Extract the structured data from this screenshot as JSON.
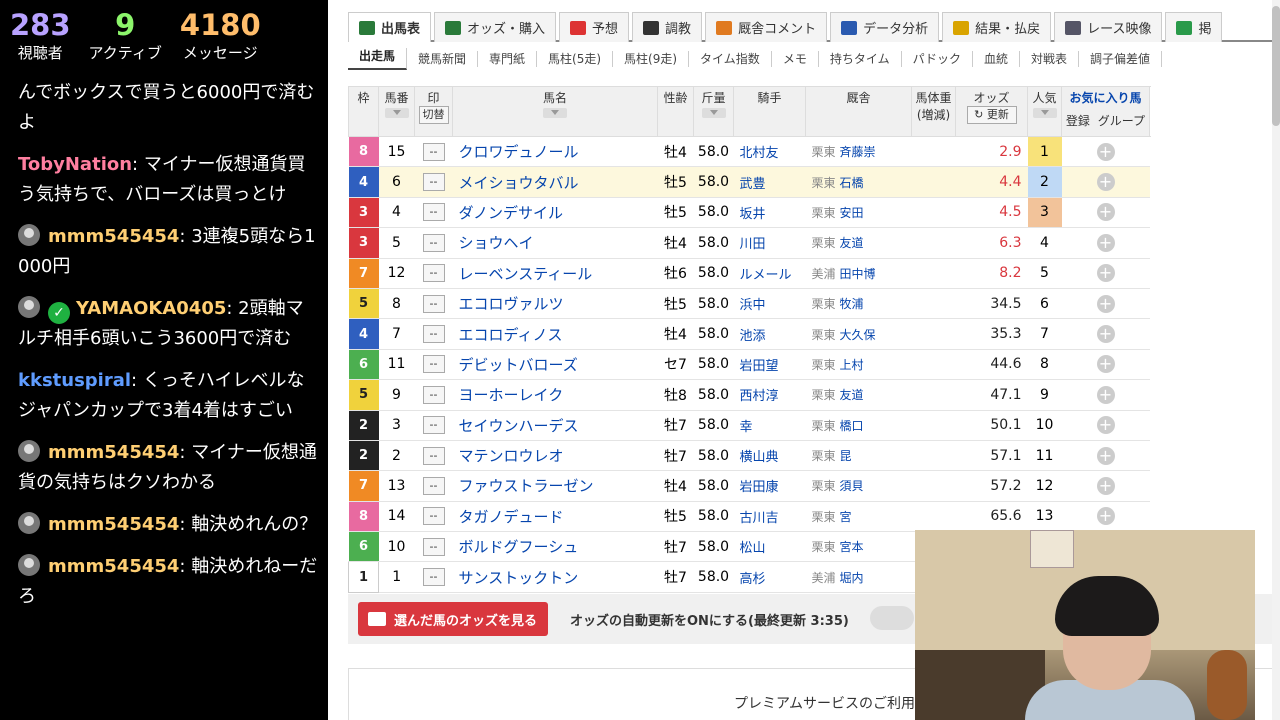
{
  "stream": {
    "stats": [
      {
        "value": "283",
        "label": "視聴者",
        "color": "#b8a2ff"
      },
      {
        "value": "9",
        "label": "アクティブ",
        "color": "#8cf56b"
      },
      {
        "value": "4180",
        "label": "メッセージ",
        "color": "#ffbd6b"
      }
    ],
    "chat": [
      {
        "user": "",
        "text": "んでボックスで買うと6000円で済むよ",
        "color": "#ffffff",
        "avatar": false,
        "verified": false
      },
      {
        "user": "TobyNation",
        "text": ": マイナー仮想通貨買う気持ちで、バローズ￼は買っとけ",
        "color": "#ff7fa0",
        "avatar": false,
        "verified": false
      },
      {
        "user": "mmm545454",
        "text": ": 3連複5頭なら1000円",
        "color": "#ffcf73",
        "avatar": true,
        "verified": false
      },
      {
        "user": "YAMAOKA0405",
        "text": ": 2頭軸マルチ相手6頭いこう3600円で済む",
        "color": "#ffcf73",
        "avatar": true,
        "verified": true
      },
      {
        "user": "kkstuspiral",
        "text": ": くっそハイレベルなジャパンカップで3着4着はすごい",
        "color": "#5f9cff",
        "avatar": false,
        "verified": false
      },
      {
        "user": "mmm545454",
        "text": ": マイナー仮想通貨の気持ちはクソわかる",
        "color": "#ffcf73",
        "avatar": true,
        "verified": false
      },
      {
        "user": "mmm545454",
        "text": ": 軸決めれんの？",
        "color": "#ffcf73",
        "avatar": true,
        "verified": false
      },
      {
        "user": "mmm545454",
        "text": ": 軸決めれねーだろ",
        "color": "#ffcf73",
        "avatar": true,
        "verified": false
      }
    ]
  },
  "tabs": [
    {
      "label": "出馬表",
      "active": true,
      "icon": "table-icon",
      "color": "#2a7a3a"
    },
    {
      "label": "オッズ・購入",
      "active": false,
      "icon": "ticket-icon",
      "color": "#2a7a3a"
    },
    {
      "label": "予想",
      "active": false,
      "icon": "target-icon",
      "color": "#d33"
    },
    {
      "label": "調教",
      "active": false,
      "icon": "stopwatch-icon",
      "color": "#333"
    },
    {
      "label": "厩舎コメント",
      "active": false,
      "icon": "house-icon",
      "color": "#e07a20"
    },
    {
      "label": "データ分析",
      "active": false,
      "icon": "bar-chart-icon",
      "color": "#2a5ab0"
    },
    {
      "label": "結果・払戻",
      "active": false,
      "icon": "coin-icon",
      "color": "#d9a400"
    },
    {
      "label": "レース映像",
      "active": false,
      "icon": "video-icon",
      "color": "#556"
    },
    {
      "label": "掲",
      "active": false,
      "icon": "chat-icon",
      "color": "#2a9a4a"
    }
  ],
  "subtabs": [
    "出走馬",
    "競馬新聞",
    "専門紙",
    "馬柱(5走)",
    "馬柱(9走)",
    "タイム指数",
    "メモ",
    "持ちタイム",
    "パドック",
    "血統",
    "対戦表",
    "調子偏差値"
  ],
  "headers": {
    "waku": "枠",
    "umaban": "馬番",
    "mark": "印",
    "mark_sub": "切替",
    "name": "馬名",
    "sex_age": "性齢",
    "weight": "斤量",
    "jockey": "騎手",
    "stable": "厩舎",
    "body": "馬体重",
    "body_sub": "(増減)",
    "odds": "オッズ",
    "odds_refresh": "更新",
    "pop": "人気",
    "fav": "お気に入り馬",
    "fav_reg": "登録",
    "fav_group": "グループ"
  },
  "horses": [
    {
      "waku": "8",
      "num": "15",
      "mark": "--",
      "name": "クロワデュノール",
      "sex_age": "牡4",
      "weight": "58.0",
      "jockey": "北村友",
      "region": "栗東",
      "trainer": "斉藤崇",
      "odds": "2.9",
      "pop": "1"
    },
    {
      "waku": "4",
      "num": "6",
      "mark": "--",
      "name": "メイショウタバル",
      "sex_age": "牡5",
      "weight": "58.0",
      "jockey": "武豊",
      "region": "栗東",
      "trainer": "石橋",
      "odds": "4.4",
      "pop": "2"
    },
    {
      "waku": "3",
      "num": "4",
      "mark": "--",
      "name": "ダノンデサイル",
      "sex_age": "牡5",
      "weight": "58.0",
      "jockey": "坂井",
      "region": "栗東",
      "trainer": "安田",
      "odds": "4.5",
      "pop": "3"
    },
    {
      "waku": "3",
      "num": "5",
      "mark": "--",
      "name": "ショウヘイ",
      "sex_age": "牡4",
      "weight": "58.0",
      "jockey": "川田",
      "region": "栗東",
      "trainer": "友道",
      "odds": "6.3",
      "pop": "4"
    },
    {
      "waku": "7",
      "num": "12",
      "mark": "--",
      "name": "レーベンスティール",
      "sex_age": "牡6",
      "weight": "58.0",
      "jockey": "ルメール",
      "region": "美浦",
      "trainer": "田中博",
      "odds": "8.2",
      "pop": "5"
    },
    {
      "waku": "5",
      "num": "8",
      "mark": "--",
      "name": "エコロヴァルツ",
      "sex_age": "牡5",
      "weight": "58.0",
      "jockey": "浜中",
      "region": "栗東",
      "trainer": "牧浦",
      "odds": "34.5",
      "pop": "6"
    },
    {
      "waku": "4",
      "num": "7",
      "mark": "--",
      "name": "エコロディノス",
      "sex_age": "牡4",
      "weight": "58.0",
      "jockey": "池添",
      "region": "栗東",
      "trainer": "大久保",
      "odds": "35.3",
      "pop": "7"
    },
    {
      "waku": "6",
      "num": "11",
      "mark": "--",
      "name": "デビットバローズ",
      "sex_age": "セ7",
      "weight": "58.0",
      "jockey": "岩田望",
      "region": "栗東",
      "trainer": "上村",
      "odds": "44.6",
      "pop": "8"
    },
    {
      "waku": "5",
      "num": "9",
      "mark": "--",
      "name": "ヨーホーレイク",
      "sex_age": "牡8",
      "weight": "58.0",
      "jockey": "西村淳",
      "region": "栗東",
      "trainer": "友道",
      "odds": "47.1",
      "pop": "9"
    },
    {
      "waku": "2",
      "num": "3",
      "mark": "--",
      "name": "セイウンハーデス",
      "sex_age": "牡7",
      "weight": "58.0",
      "jockey": "幸",
      "region": "栗東",
      "trainer": "橋口",
      "odds": "50.1",
      "pop": "10"
    },
    {
      "waku": "2",
      "num": "2",
      "mark": "--",
      "name": "マテンロウレオ",
      "sex_age": "牡7",
      "weight": "58.0",
      "jockey": "横山典",
      "region": "栗東",
      "trainer": "昆",
      "odds": "57.1",
      "pop": "11"
    },
    {
      "waku": "7",
      "num": "13",
      "mark": "--",
      "name": "ファウストラーゼン",
      "sex_age": "牡4",
      "weight": "58.0",
      "jockey": "岩田康",
      "region": "栗東",
      "trainer": "須貝",
      "odds": "57.2",
      "pop": "12"
    },
    {
      "waku": "8",
      "num": "14",
      "mark": "--",
      "name": "タガノデュード",
      "sex_age": "牡5",
      "weight": "58.0",
      "jockey": "古川吉",
      "region": "栗東",
      "trainer": "宮",
      "odds": "65.6",
      "pop": "13"
    },
    {
      "waku": "6",
      "num": "10",
      "mark": "--",
      "name": "ボルドグフーシュ",
      "sex_age": "牡7",
      "weight": "58.0",
      "jockey": "松山",
      "region": "栗東",
      "trainer": "宮本",
      "odds": "",
      "pop": ""
    },
    {
      "waku": "1",
      "num": "1",
      "mark": "--",
      "name": "サンストックトン",
      "sex_age": "牡7",
      "weight": "58.0",
      "jockey": "高杉",
      "region": "美浦",
      "trainer": "堀内",
      "odds": "",
      "pop": ""
    }
  ],
  "waku_colors": {
    "1": "#ffffff",
    "2": "#222222",
    "3": "#d9373e",
    "4": "#2f5fbf",
    "5": "#f0d23c",
    "6": "#4caf50",
    "7": "#f08a24",
    "8": "#e86aa0"
  },
  "pop_colors": {
    "1": "#f8e27a",
    "2": "#bfd9f5",
    "3": "#f2c39a"
  },
  "bottom": {
    "odds_button": "選んだ馬のオッズを見る",
    "auto_update": "オッズの自動更新をONにする(最終更新 3:35)",
    "premium": "プレミアムサービスのご利用"
  }
}
